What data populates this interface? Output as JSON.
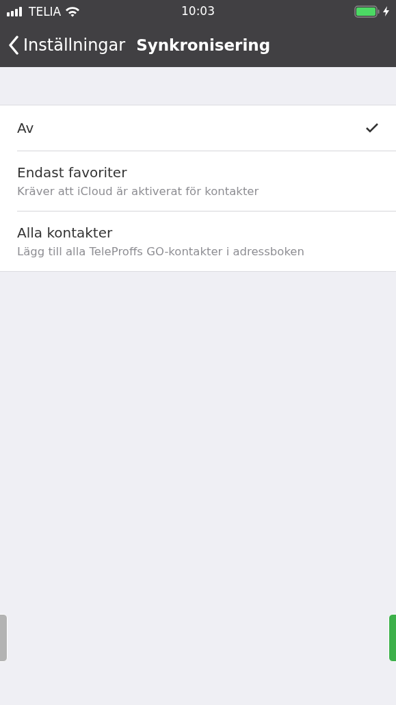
{
  "status_bar": {
    "carrier": "TELIA",
    "time": "10:03"
  },
  "nav_bar": {
    "back_label": "Inställningar",
    "title": "Synkronisering"
  },
  "options": [
    {
      "title": "Av",
      "selected": true
    },
    {
      "title": "Endast favoriter",
      "subtitle": "Kräver att iCloud är aktiverat för kontakter",
      "selected": false
    },
    {
      "title": "Alla kontakter",
      "subtitle": "Lägg till alla TeleProffs GO-kontakter i adressboken",
      "selected": false
    }
  ]
}
